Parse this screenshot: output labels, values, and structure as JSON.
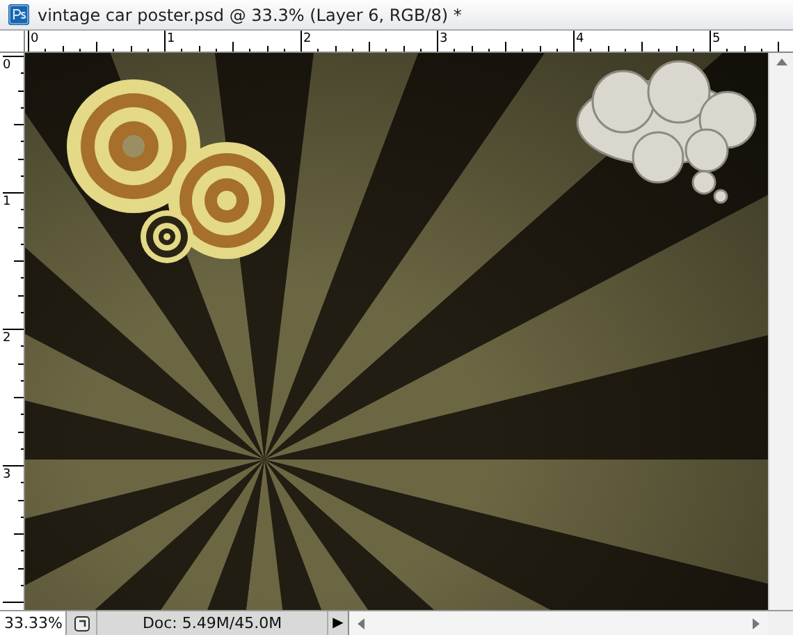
{
  "window": {
    "title": "vintage car poster.psd @ 33.3% (Layer 6, RGB/8) *"
  },
  "rulers": {
    "horizontal": [
      "0",
      "1",
      "2",
      "3",
      "4",
      "5"
    ],
    "vertical": [
      "0",
      "1",
      "2",
      "3"
    ]
  },
  "status_bar": {
    "zoom": "33.33%",
    "doc_info": "Doc: 5.49M/45.0M",
    "menu_arrow": "▶"
  }
}
